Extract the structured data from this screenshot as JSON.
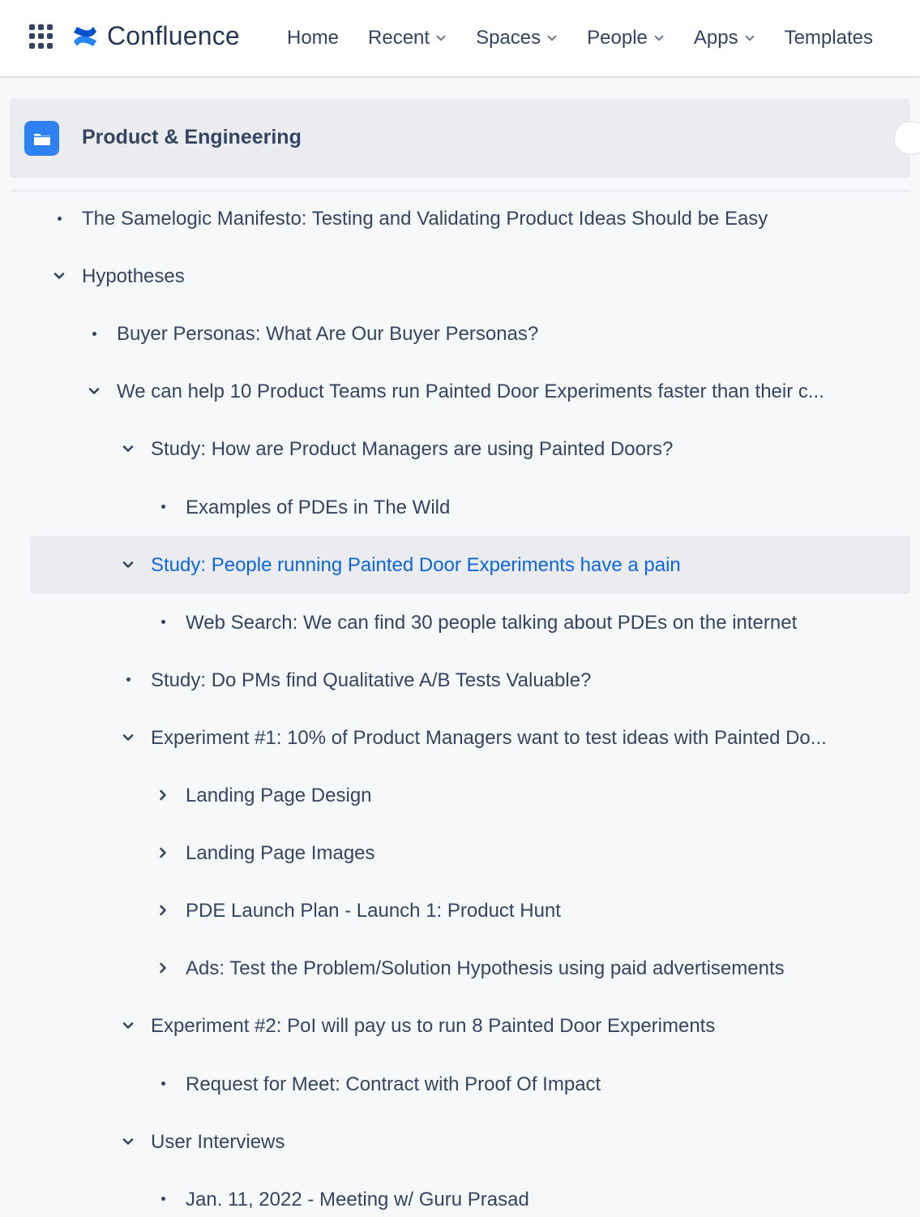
{
  "header": {
    "app_name": "Confluence",
    "nav": [
      {
        "label": "Home",
        "has_dropdown": false
      },
      {
        "label": "Recent",
        "has_dropdown": true
      },
      {
        "label": "Spaces",
        "has_dropdown": true
      },
      {
        "label": "People",
        "has_dropdown": true
      },
      {
        "label": "Apps",
        "has_dropdown": true
      },
      {
        "label": "Templates",
        "has_dropdown": false
      }
    ]
  },
  "space": {
    "name": "Product & Engineering",
    "icon": "folder-icon",
    "icon_color": "#2f80f0"
  },
  "colors": {
    "selected_text": "#0c66e4",
    "text": "#344563"
  },
  "tree": [
    {
      "label": "The Samelogic Manifesto: Testing and Validating Product Ideas Should be Easy",
      "level": 0,
      "control": "bullet"
    },
    {
      "label": "Hypotheses",
      "level": 0,
      "control": "expanded"
    },
    {
      "label": "Buyer Personas: What Are Our Buyer Personas?",
      "level": 1,
      "control": "bullet"
    },
    {
      "label": "We can help 10 Product Teams run Painted Door Experiments faster than their c...",
      "level": 1,
      "control": "expanded"
    },
    {
      "label": "Study: How are Product Managers are using Painted Doors?",
      "level": 2,
      "control": "expanded"
    },
    {
      "label": "Examples of PDEs in The Wild",
      "level": 3,
      "control": "bullet"
    },
    {
      "label": "Study: People running Painted Door Experiments have a pain",
      "level": 2,
      "control": "expanded",
      "selected": true
    },
    {
      "label": "Web Search: We can find 30 people talking about PDEs on the internet",
      "level": 3,
      "control": "bullet"
    },
    {
      "label": "Study: Do PMs find Qualitative A/B Tests Valuable?",
      "level": 2,
      "control": "bullet"
    },
    {
      "label": "Experiment #1: 10% of Product Managers want to test ideas with Painted Do...",
      "level": 2,
      "control": "expanded"
    },
    {
      "label": "Landing Page Design",
      "level": 3,
      "control": "collapsed"
    },
    {
      "label": "Landing Page Images",
      "level": 3,
      "control": "collapsed"
    },
    {
      "label": "PDE Launch Plan - Launch 1: Product Hunt",
      "level": 3,
      "control": "collapsed"
    },
    {
      "label": "Ads: Test the Problem/Solution Hypothesis using paid advertisements",
      "level": 3,
      "control": "collapsed"
    },
    {
      "label": "Experiment #2: PoI will pay us to run 8 Painted Door Experiments",
      "level": 2,
      "control": "expanded"
    },
    {
      "label": "Request for Meet: Contract with Proof Of Impact",
      "level": 3,
      "control": "bullet"
    },
    {
      "label": "User Interviews",
      "level": 2,
      "control": "expanded"
    },
    {
      "label": "Jan. 11, 2022 - Meeting w/ Guru Prasad",
      "level": 3,
      "control": "bullet"
    }
  ]
}
